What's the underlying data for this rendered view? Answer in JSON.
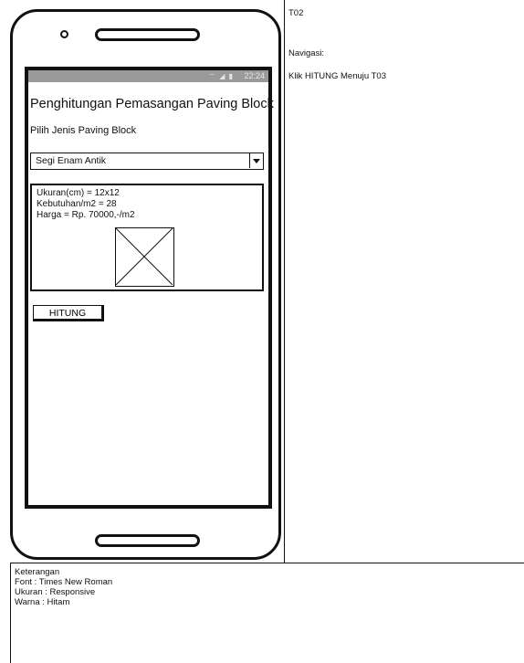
{
  "phone": {
    "status_time": "22:24",
    "status_icons": "⌔ ◢ ▮"
  },
  "app": {
    "title": "Penghitungan Pemasangan Paving Block",
    "subtitle": "Pilih Jenis Paving Block",
    "select_value": "Segi Enam Antik",
    "info": {
      "ukuran": "Ukuran(cm) = 12x12",
      "kebutuhan": "Kebutuhan/m2 = 28",
      "harga": "Harga = Rp. 70000,-/m2"
    },
    "button_label": "HITUNG"
  },
  "right_panel": {
    "page_id": "T02",
    "nav_heading": "Navigasi:",
    "nav_text": "Klik HITUNG Menuju T03"
  },
  "notes": {
    "heading": "Keterangan",
    "font": "Font : Times New Roman",
    "ukuran": "Ukuran : Responsive",
    "warna": "Warna : Hitam"
  }
}
